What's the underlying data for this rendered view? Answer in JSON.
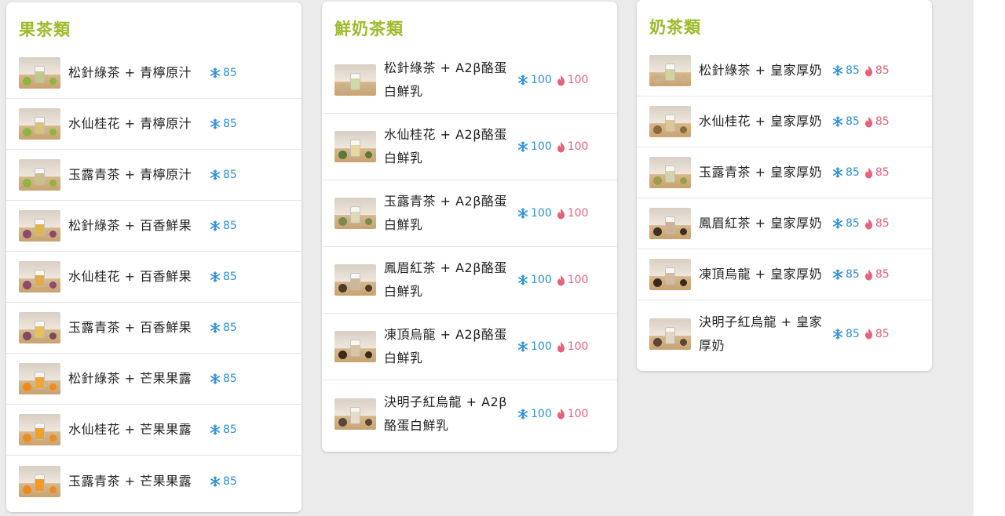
{
  "colors": {
    "title": "#9bbb2b",
    "ice": "#2d8fd6",
    "hot": "#e8607a"
  },
  "sections": [
    {
      "title": "果茶類",
      "items": [
        {
          "name": "松針綠茶 + 青檸原汁",
          "ice": "85",
          "hot": null,
          "liquid": "#bfc98a",
          "fruit": "#8db540"
        },
        {
          "name": "水仙桂花 + 青檸原汁",
          "ice": "85",
          "hot": null,
          "liquid": "#d7c27a",
          "fruit": "#8db540"
        },
        {
          "name": "玉露青茶 + 青檸原汁",
          "ice": "85",
          "hot": null,
          "liquid": "#c9c08a",
          "fruit": "#8db540"
        },
        {
          "name": "松針綠茶 + 百香鮮果",
          "ice": "85",
          "hot": null,
          "liquid": "#e0b64a",
          "fruit": "#8b4a6a"
        },
        {
          "name": "水仙桂花 + 百香鮮果",
          "ice": "85",
          "hot": null,
          "liquid": "#e3a94a",
          "fruit": "#8b4a6a"
        },
        {
          "name": "玉露青茶 + 百香鮮果",
          "ice": "85",
          "hot": null,
          "liquid": "#e8c05a",
          "fruit": "#7e4a5e"
        },
        {
          "name": "松針綠茶 + 芒果果露",
          "ice": "85",
          "hot": null,
          "liquid": "#f0a632",
          "fruit": "#f08a1e"
        },
        {
          "name": "水仙桂花 + 芒果果露",
          "ice": "85",
          "hot": null,
          "liquid": "#f3a02a",
          "fruit": "#f08a1e"
        },
        {
          "name": "玉露青茶 + 芒果果露",
          "ice": "85",
          "hot": null,
          "liquid": "#f29a22",
          "fruit": "#f08a1e"
        }
      ]
    },
    {
      "title": "鮮奶茶類",
      "items": [
        {
          "name": "松針綠茶 + A2β酪蛋白鮮乳",
          "ice": "100",
          "hot": "100",
          "liquid": "#cfd8a8",
          "fruit": "#c8b08a"
        },
        {
          "name": "水仙桂花 + A2β酪蛋白鮮乳",
          "ice": "100",
          "hot": "100",
          "liquid": "#e8d7a0",
          "fruit": "#5a7a3a"
        },
        {
          "name": "玉露青茶 + A2β酪蛋白鮮乳",
          "ice": "100",
          "hot": "100",
          "liquid": "#dcd8b8",
          "fruit": "#7a8a4a"
        },
        {
          "name": "鳳眉紅茶 + A2β酪蛋白鮮乳",
          "ice": "100",
          "hot": "100",
          "liquid": "#cdb79a",
          "fruit": "#4a3a2a"
        },
        {
          "name": "凍頂烏龍 + A2β酪蛋白鮮乳",
          "ice": "100",
          "hot": "100",
          "liquid": "#d8c5a8",
          "fruit": "#3a2a1e"
        },
        {
          "name": "決明子紅烏龍 + A2β酪蛋白鮮乳",
          "ice": "100",
          "hot": "100",
          "liquid": "#e6dccc",
          "fruit": "#5a4636"
        }
      ]
    },
    {
      "title": "奶茶類",
      "items": [
        {
          "name": "松針綠茶 + 皇家厚奶",
          "ice": "85",
          "hot": "85",
          "liquid": "#cfd3a2",
          "fruit": "#c8b08a"
        },
        {
          "name": "水仙桂花 + 皇家厚奶",
          "ice": "85",
          "hot": "85",
          "liquid": "#dcc896",
          "fruit": "#8a6a3a"
        },
        {
          "name": "玉露青茶 + 皇家厚奶",
          "ice": "85",
          "hot": "85",
          "liquid": "#d3d4ae",
          "fruit": "#9aa04a"
        },
        {
          "name": "鳳眉紅茶 + 皇家厚奶",
          "ice": "85",
          "hot": "85",
          "liquid": "#cbb290",
          "fruit": "#3e2e22"
        },
        {
          "name": "凍頂烏龍 + 皇家厚奶",
          "ice": "85",
          "hot": "85",
          "liquid": "#d0bca0",
          "fruit": "#3a2a1e"
        },
        {
          "name": "決明子紅烏龍 + 皇家厚奶",
          "ice": "85",
          "hot": "85",
          "liquid": "#e2d6c4",
          "fruit": "#5a4636"
        }
      ]
    }
  ]
}
